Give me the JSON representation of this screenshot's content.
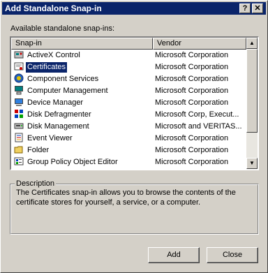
{
  "window": {
    "title": "Add Standalone Snap-in",
    "help_label": "?",
    "close_label": "✕"
  },
  "list_label": "Available standalone snap-ins:",
  "columns": {
    "name": "Snap-in",
    "vendor": "Vendor"
  },
  "rows": [
    {
      "name": "ActiveX Control",
      "vendor": "Microsoft Corporation",
      "icon": "activex-icon"
    },
    {
      "name": "Certificates",
      "vendor": "Microsoft Corporation",
      "icon": "certificates-icon",
      "selected": true
    },
    {
      "name": "Component Services",
      "vendor": "Microsoft Corporation",
      "icon": "component-services-icon"
    },
    {
      "name": "Computer Management",
      "vendor": "Microsoft Corporation",
      "icon": "computer-management-icon"
    },
    {
      "name": "Device Manager",
      "vendor": "Microsoft Corporation",
      "icon": "device-manager-icon"
    },
    {
      "name": "Disk Defragmenter",
      "vendor": "Microsoft Corp, Execut...",
      "icon": "disk-defragmenter-icon"
    },
    {
      "name": "Disk Management",
      "vendor": "Microsoft and VERITAS...",
      "icon": "disk-management-icon"
    },
    {
      "name": "Event Viewer",
      "vendor": "Microsoft Corporation",
      "icon": "event-viewer-icon"
    },
    {
      "name": "Folder",
      "vendor": "Microsoft Corporation",
      "icon": "folder-icon"
    },
    {
      "name": "Group Policy Object Editor",
      "vendor": "Microsoft Corporation",
      "icon": "group-policy-icon"
    }
  ],
  "description": {
    "legend": "Description",
    "text": "The Certificates snap-in allows you to browse the contents of the certificate stores for yourself, a service, or a computer."
  },
  "buttons": {
    "add": "Add",
    "close": "Close"
  }
}
